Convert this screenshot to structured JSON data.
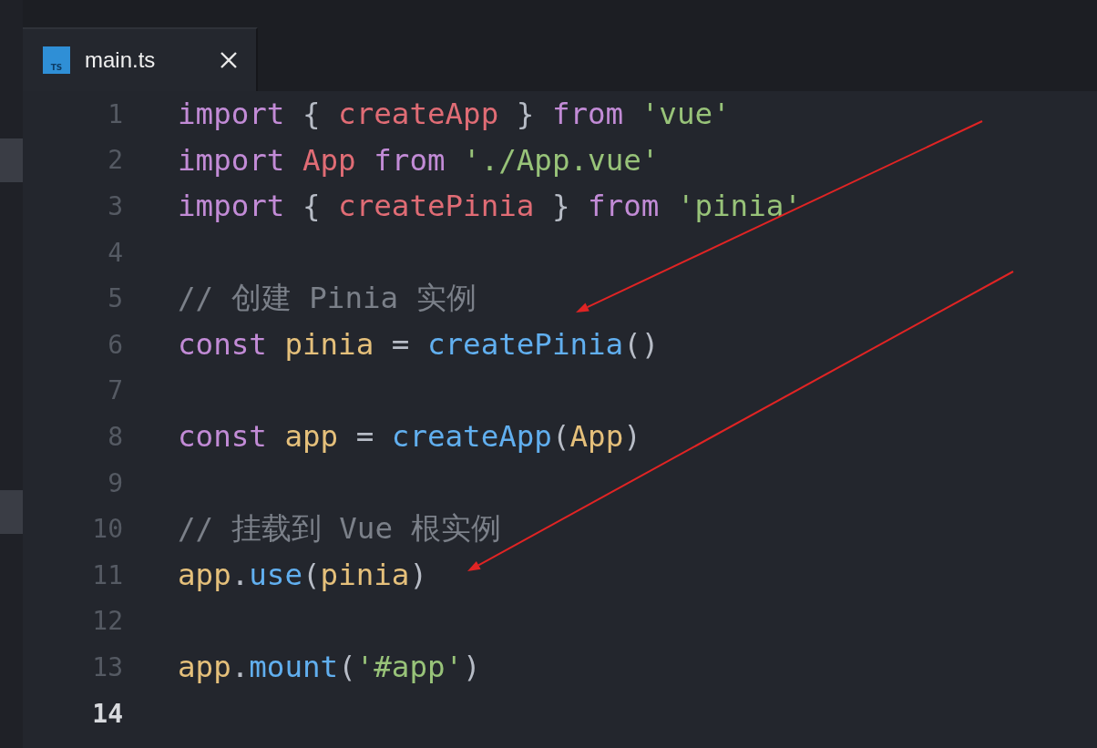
{
  "tabs": [
    {
      "label": "main.ts",
      "icon_label": "TS",
      "selected": true
    }
  ],
  "editor": {
    "lines": [
      {
        "number": "1",
        "current": false,
        "tokens": [
          {
            "kind": "keyword",
            "text": "import"
          },
          {
            "kind": "punct",
            "text": " { "
          },
          {
            "kind": "name",
            "text": "createApp"
          },
          {
            "kind": "punct",
            "text": " } "
          },
          {
            "kind": "keyword",
            "text": "from"
          },
          {
            "kind": "string",
            "text": " 'vue'"
          }
        ]
      },
      {
        "number": "2",
        "current": false,
        "tokens": [
          {
            "kind": "keyword",
            "text": "import"
          },
          {
            "kind": "name",
            "text": " App"
          },
          {
            "kind": "keyword",
            "text": " from"
          },
          {
            "kind": "string",
            "text": " './App.vue'"
          }
        ]
      },
      {
        "number": "3",
        "current": false,
        "tokens": [
          {
            "kind": "keyword",
            "text": "import"
          },
          {
            "kind": "punct",
            "text": " { "
          },
          {
            "kind": "name",
            "text": "createPinia"
          },
          {
            "kind": "punct",
            "text": " } "
          },
          {
            "kind": "keyword",
            "text": "from"
          },
          {
            "kind": "string",
            "text": " 'pinia'"
          }
        ]
      },
      {
        "number": "4",
        "current": false
      },
      {
        "number": "5",
        "current": false,
        "tokens": [
          {
            "kind": "comment",
            "text": "// 创建 Pinia 实例"
          }
        ]
      },
      {
        "number": "6",
        "current": false,
        "tokens": [
          {
            "kind": "keyword",
            "text": "const"
          },
          {
            "kind": "variable",
            "text": " pinia"
          },
          {
            "kind": "punct",
            "text": " = "
          },
          {
            "kind": "function",
            "text": "createPinia"
          },
          {
            "kind": "punct",
            "text": "()"
          }
        ]
      },
      {
        "number": "7",
        "current": false
      },
      {
        "number": "8",
        "current": false,
        "tokens": [
          {
            "kind": "keyword",
            "text": "const"
          },
          {
            "kind": "variable",
            "text": " app"
          },
          {
            "kind": "punct",
            "text": " = "
          },
          {
            "kind": "function",
            "text": "createApp"
          },
          {
            "kind": "punct",
            "text": "("
          },
          {
            "kind": "variable",
            "text": "App"
          },
          {
            "kind": "punct",
            "text": ")"
          }
        ]
      },
      {
        "number": "9",
        "current": false
      },
      {
        "number": "10",
        "current": false,
        "tokens": [
          {
            "kind": "comment",
            "text": "// 挂载到 Vue 根实例"
          }
        ]
      },
      {
        "number": "11",
        "current": false,
        "tokens": [
          {
            "kind": "variable",
            "text": "app"
          },
          {
            "kind": "punct",
            "text": "."
          },
          {
            "kind": "function",
            "text": "use"
          },
          {
            "kind": "punct",
            "text": "("
          },
          {
            "kind": "variable",
            "text": "pinia"
          },
          {
            "kind": "punct",
            "text": ")"
          }
        ]
      },
      {
        "number": "12",
        "current": false
      },
      {
        "number": "13",
        "current": false,
        "tokens": [
          {
            "kind": "variable",
            "text": "app"
          },
          {
            "kind": "punct",
            "text": "."
          },
          {
            "kind": "function",
            "text": "mount"
          },
          {
            "kind": "punct",
            "text": "("
          },
          {
            "kind": "string",
            "text": "'#app'"
          },
          {
            "kind": "punct",
            "text": ")"
          }
        ]
      },
      {
        "number": "14",
        "current": true
      }
    ]
  },
  "annotations": [
    {
      "kind": "arrow",
      "color": "#e02424"
    },
    {
      "kind": "arrow",
      "color": "#e02424"
    }
  ]
}
